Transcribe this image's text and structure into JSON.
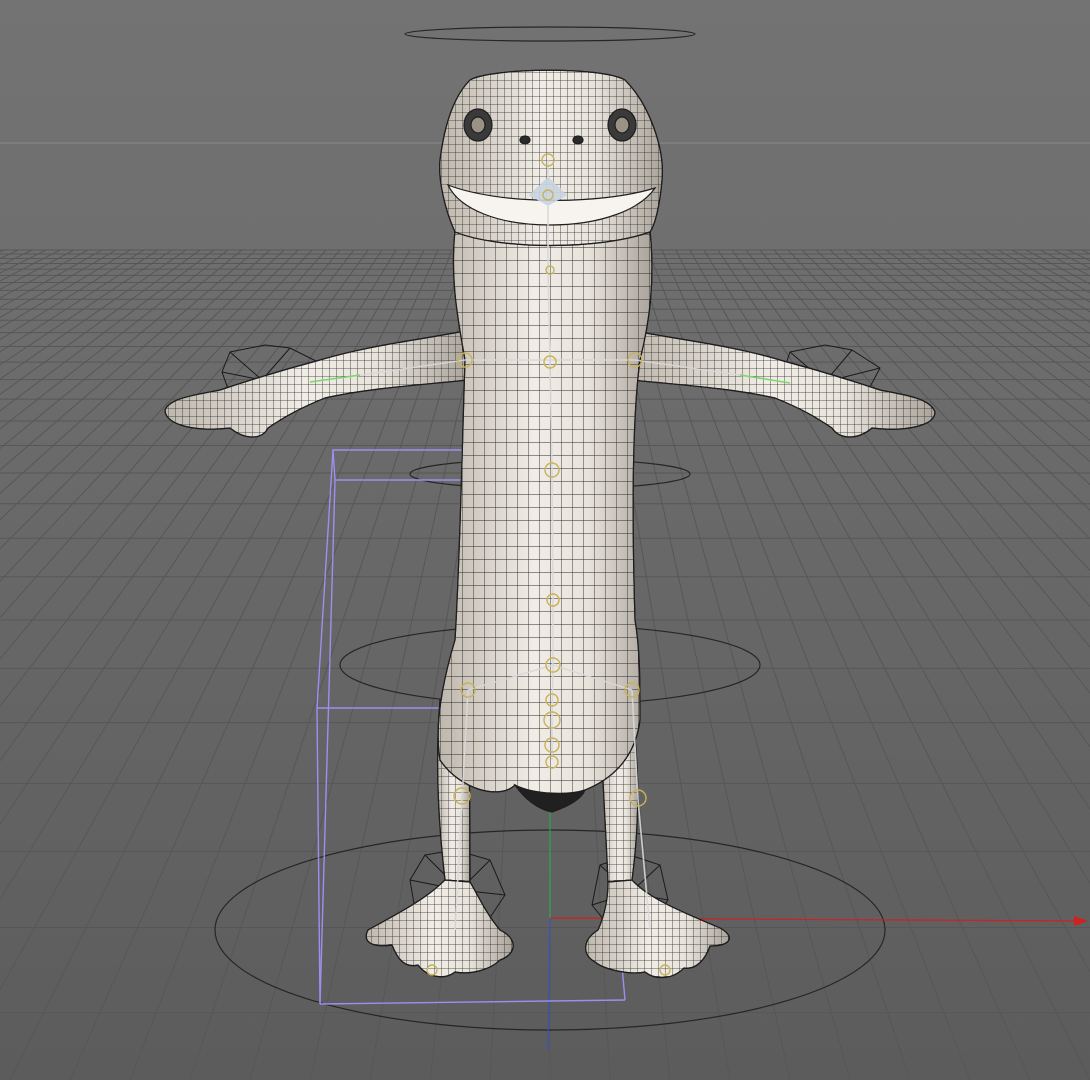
{
  "viewport": {
    "background": "#6e6e6e",
    "floor_grid_color": "#585858",
    "horizon_color": "#8a8a8a"
  },
  "model": {
    "skin_color": "#e6e0d6",
    "wire_color": "#1e1e1e",
    "joint_color": "#c8b25a"
  },
  "controllers": {
    "circle_color": "#2a2a2a",
    "ik_box_color": "#9d8ff0",
    "axis_x_color": "#d02020",
    "axis_y_color": "#2ea84a",
    "axis_z_color": "#3050d0"
  },
  "icons": [
    "root-controller-circle",
    "hip-controller-circle",
    "chest-controller-circle",
    "head-controller-circle",
    "hand-ik-gizmo",
    "foot-ik-gizmo"
  ]
}
